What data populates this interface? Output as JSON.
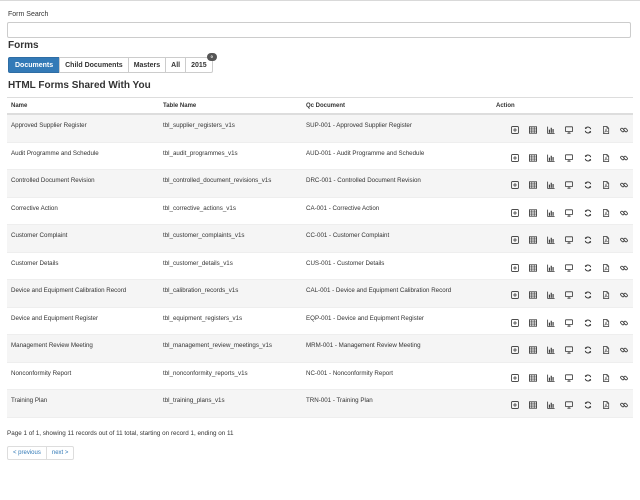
{
  "search": {
    "label": "Form Search",
    "value": "",
    "placeholder": ""
  },
  "forms_heading": "Forms",
  "tabs": [
    {
      "label": "Documents",
      "active": true
    },
    {
      "label": "Child Documents",
      "active": false
    },
    {
      "label": "Masters",
      "active": false
    },
    {
      "label": "All",
      "active": false
    },
    {
      "label": "2015",
      "active": false,
      "badge": "0"
    }
  ],
  "section_heading": "HTML Forms Shared With You",
  "table": {
    "headers": [
      "Name",
      "Table Name",
      "Qc Document",
      "Action"
    ],
    "rows": [
      {
        "name": "Approved Supplier Register",
        "table_name": "tbl_supplier_registers_v1s",
        "qc_document": "SUP-001 - Approved Supplier Register"
      },
      {
        "name": "Audit Programme and Schedule",
        "table_name": "tbl_audit_programmes_v1s",
        "qc_document": "AUD-001 - Audit Programme and Schedule"
      },
      {
        "name": "Controlled Document Revision",
        "table_name": "tbl_controlled_document_revisions_v1s",
        "qc_document": "DRC-001 - Controlled Document Revision"
      },
      {
        "name": "Corrective Action",
        "table_name": "tbl_corrective_actions_v1s",
        "qc_document": "CA-001 - Corrective Action"
      },
      {
        "name": "Customer Complaint",
        "table_name": "tbl_customer_complaints_v1s",
        "qc_document": "CC-001 - Customer Complaint"
      },
      {
        "name": "Customer Details",
        "table_name": "tbl_customer_details_v1s",
        "qc_document": "CUS-001 - Customer Details"
      },
      {
        "name": "Device and Equipment Calibration Record",
        "table_name": "tbl_calibration_records_v1s",
        "qc_document": "CAL-001 - Device and Equipment Calibration Record"
      },
      {
        "name": "Device and Equipment Register",
        "table_name": "tbl_equipment_registers_v1s",
        "qc_document": "EQP-001 - Device and Equipment Register"
      },
      {
        "name": "Management Review Meeting",
        "table_name": "tbl_management_review_meetings_v1s",
        "qc_document": "MRM-001 - Management Review Meeting"
      },
      {
        "name": "Nonconformity Report",
        "table_name": "tbl_nonconformity_reports_v1s",
        "qc_document": "NC-001 - Nonconformity Report"
      },
      {
        "name": "Training Plan",
        "table_name": "tbl_training_plans_v1s",
        "qc_document": "TRN-001 - Training Plan"
      }
    ],
    "action_icons": [
      "add-record-icon",
      "table-grid-icon",
      "bar-chart-icon",
      "monitor-icon",
      "refresh-icon",
      "pdf-file-icon",
      "link-icon"
    ]
  },
  "pagination": {
    "summary": "Page 1 of 1, showing 11 records out of 11 total, starting on record 1, ending on 11",
    "previous": "< previous",
    "next": "next >"
  },
  "colors": {
    "primary": "#337ab7",
    "row_stripe": "#f5f5f5",
    "border": "#dddddd"
  }
}
